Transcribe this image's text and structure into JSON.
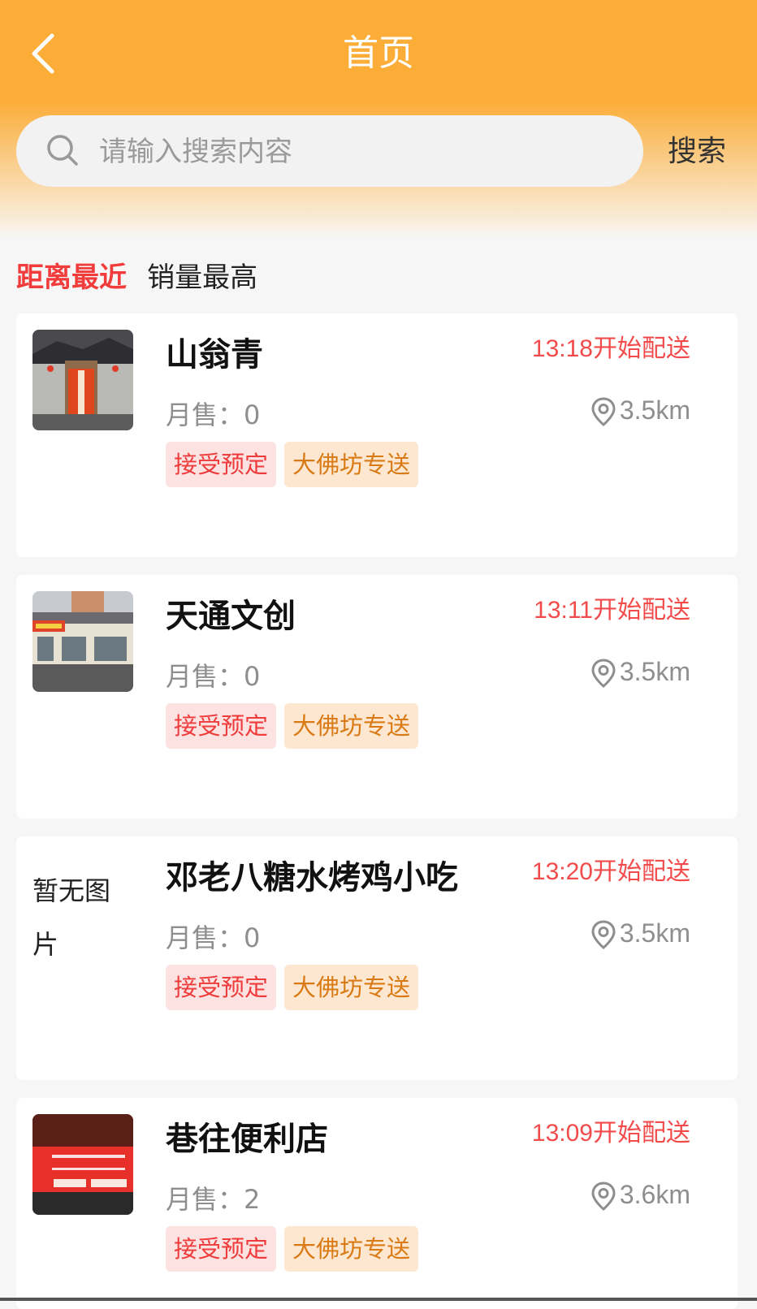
{
  "header": {
    "title": "首页",
    "search_placeholder": "请输入搜索内容",
    "search_button": "搜索"
  },
  "sort_tabs": [
    {
      "label": "距离最近",
      "active": true
    },
    {
      "label": "销量最高",
      "active": false
    }
  ],
  "stores": [
    {
      "name": "山翁青",
      "delivery_time": "13:18开始配送",
      "monthly_sales": "月售：0",
      "distance": "3.5km",
      "tags": [
        "接受预定",
        "大佛坊专送"
      ],
      "has_image": true
    },
    {
      "name": "天通文创",
      "delivery_time": "13:11开始配送",
      "monthly_sales": "月售：0",
      "distance": "3.5km",
      "tags": [
        "接受预定",
        "大佛坊专送"
      ],
      "has_image": true
    },
    {
      "name": "邓老八糖水烤鸡小吃",
      "delivery_time": "13:20开始配送",
      "monthly_sales": "月售：0",
      "distance": "3.5km",
      "tags": [
        "接受预定",
        "大佛坊专送"
      ],
      "has_image": false,
      "no_image_text": "暂无图片"
    },
    {
      "name": "巷往便利店",
      "delivery_time": "13:09开始配送",
      "monthly_sales": "月售：2",
      "distance": "3.6km",
      "tags": [
        "接受预定",
        "大佛坊专送"
      ],
      "has_image": true
    }
  ],
  "colors": {
    "header": "#fbad38",
    "accent_red": "#f23c3c",
    "tag_delivery": "#d97a14"
  }
}
